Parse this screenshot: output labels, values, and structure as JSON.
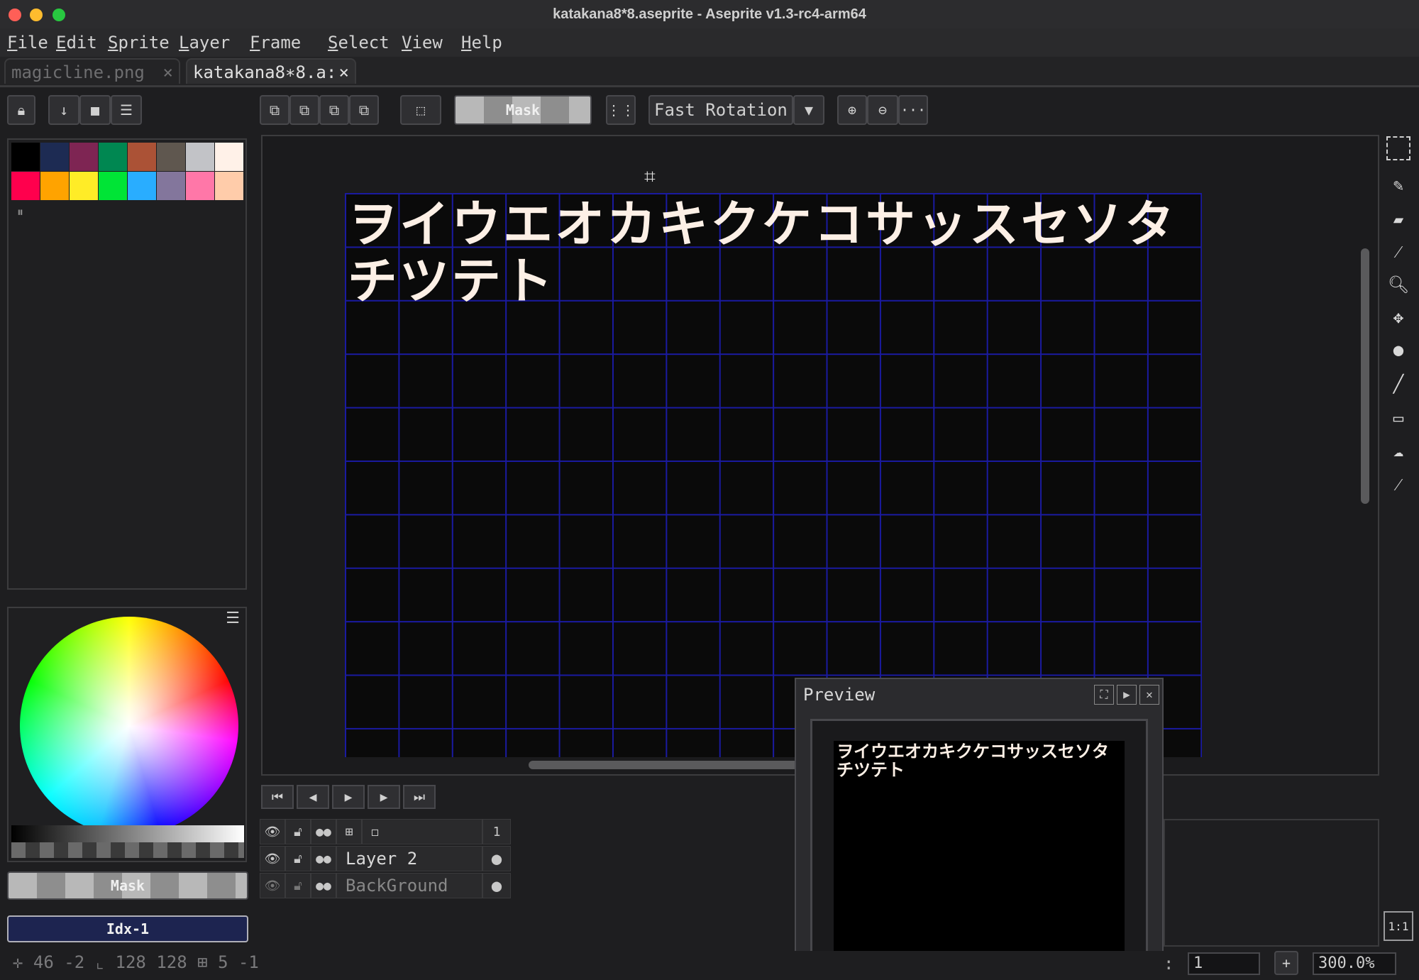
{
  "window": {
    "title": "katakana8*8.aseprite - Aseprite v1.3-rc4-arm64",
    "traffic_lights": {
      "close": "#ff5f57",
      "minimize": "#febc2e",
      "zoom": "#28c840"
    }
  },
  "menu": [
    "File",
    "Edit",
    "Sprite",
    "Layer",
    "Frame",
    "Select",
    "View",
    "Help"
  ],
  "tabs": [
    {
      "label": "magicline.png",
      "close": "×"
    },
    {
      "label": "katakana8∗8.a:",
      "close": "×"
    }
  ],
  "toolbar": {
    "mask_label": "Mask",
    "rotation_algorithm": "Fast Rotation",
    "more_label": "···"
  },
  "palette": {
    "swatches": [
      "#000000",
      "#1d2b53",
      "#7e2553",
      "#008751",
      "#ab5236",
      "#5f574f",
      "#c2c3c7",
      "#fff1e8",
      "#ff004d",
      "#ffa300",
      "#ffec27",
      "#00e436",
      "#29adff",
      "#83769c",
      "#ff77a8",
      "#ffccaa"
    ],
    "handle": "⏸"
  },
  "color_bar": {
    "mask_label": "Mask",
    "index_label": "Idx-1"
  },
  "canvas": {
    "row1": "ヲイウエオカキクケコサッスセソタ",
    "row2": "チツテト",
    "grid_color": "#1a1aa0",
    "text_color": "#fdf0e6"
  },
  "timeline": {
    "frame_number": "1",
    "layers": [
      {
        "name": "Layer 2"
      },
      {
        "name": "BackGround"
      }
    ]
  },
  "preview": {
    "title": "Preview",
    "row1": "ヲイウエオカキクケコサッスセソタ",
    "row2": "チツテト"
  },
  "status": {
    "cursor_x": "46",
    "cursor_y": "-2",
    "size_w": "128",
    "size_h": "128",
    "grid_x": "5",
    "grid_y": "-1",
    "frame_label": ":",
    "frame_value": "1",
    "add_label": "+",
    "zoom": "300.0%",
    "one_to_one": "1:1"
  }
}
